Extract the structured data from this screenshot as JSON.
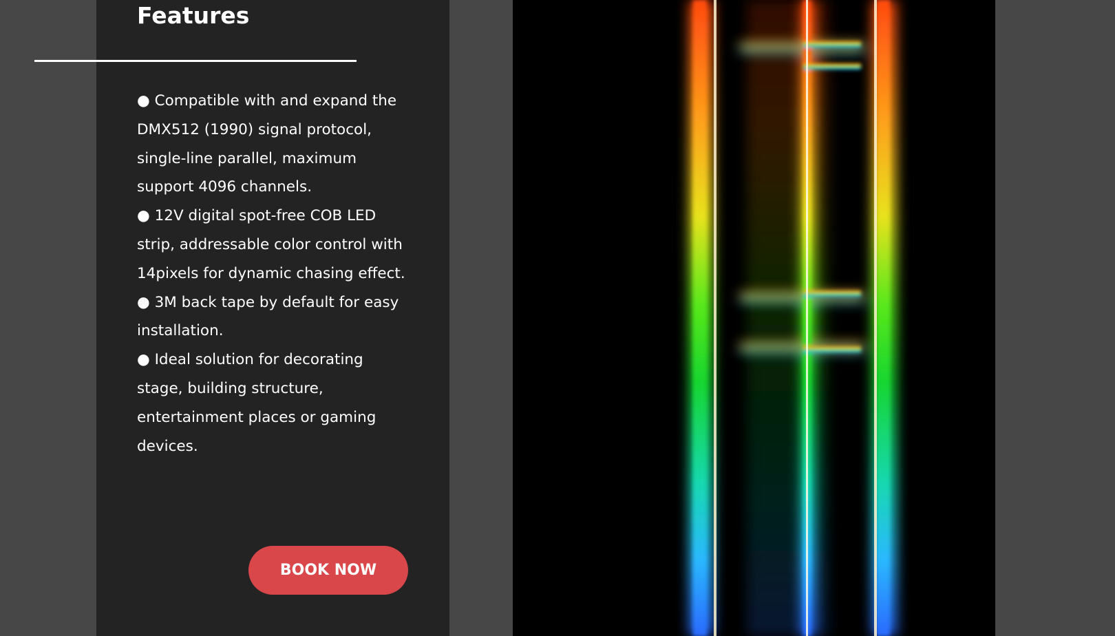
{
  "features": {
    "title": "Features",
    "items": [
      "● Compatible with and expand the DMX512 (1990) signal protocol, single-line parallel, maximum support 4096 channels.",
      "● 12V digital spot-free COB LED strip, addressable color control with 14pixels for dynamic chasing effect.",
      "● 3M back tape by default for easy installation.",
      "● Ideal solution for decorating stage, building structure, entertainment places or gaming devices."
    ],
    "button_label": "BOOK NOW"
  },
  "colors": {
    "page_bg": "#474747",
    "panel_bg": "#232323",
    "button_bg": "#d9474a",
    "text": "#ffffff"
  }
}
